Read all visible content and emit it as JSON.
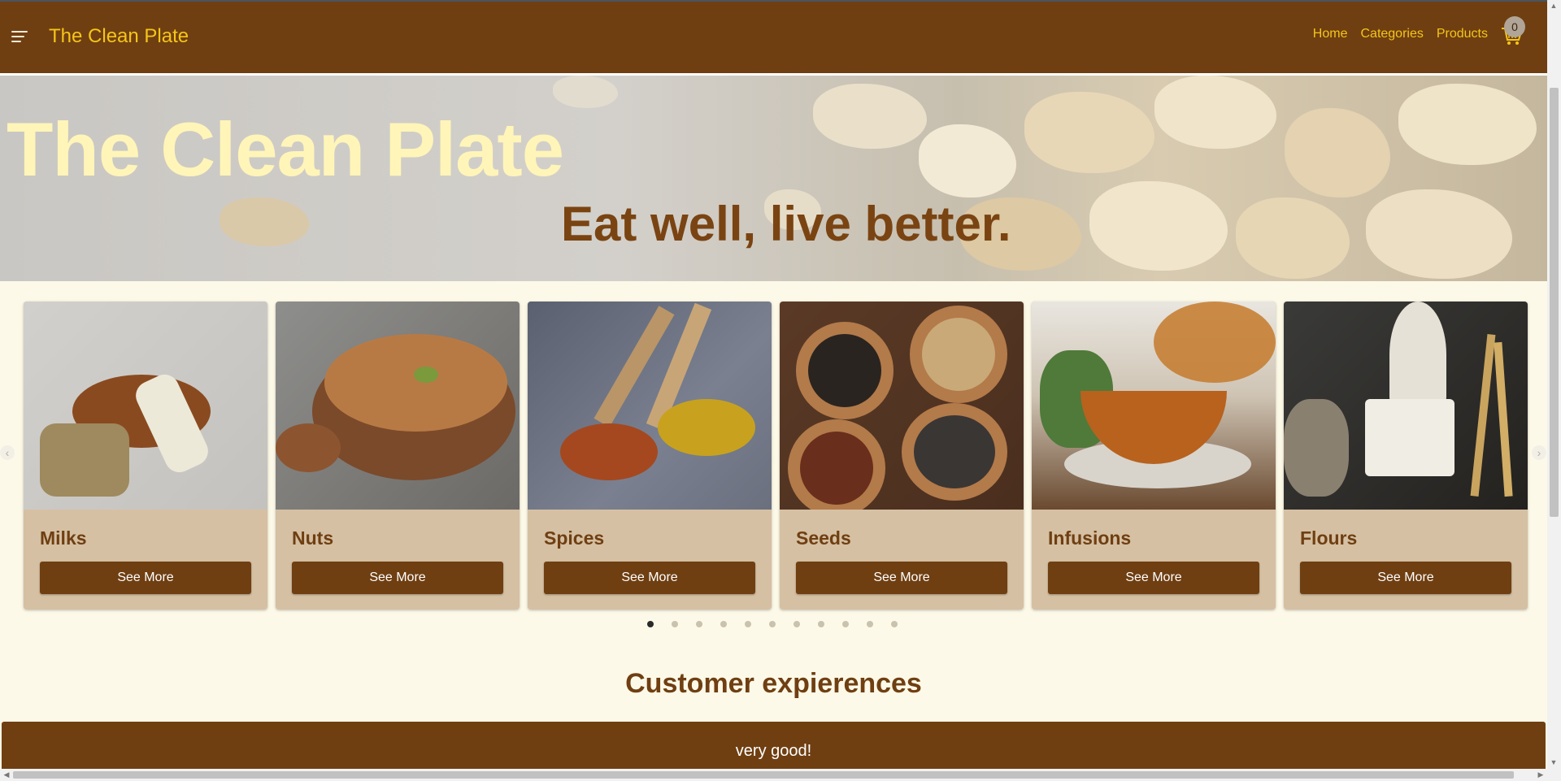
{
  "header": {
    "menu_icon": "hamburger-menu-icon",
    "brand": "The Clean Plate",
    "nav": [
      "Home",
      "Categories",
      "Products"
    ],
    "cart_icon": "shopping-cart-icon",
    "cart_count": "0"
  },
  "hero": {
    "title": "The Clean Plate",
    "subtitle": "Eat well, live better."
  },
  "categories": [
    {
      "name": "Milks",
      "button": "See More"
    },
    {
      "name": "Nuts",
      "button": "See More"
    },
    {
      "name": "Spices",
      "button": "See More"
    },
    {
      "name": "Seeds",
      "button": "See More"
    },
    {
      "name": "Infusions",
      "button": "See More"
    },
    {
      "name": "Flours",
      "button": "See More"
    }
  ],
  "carousel": {
    "page_count": 11,
    "active_page": 1
  },
  "experiences": {
    "title": "Customer expierences",
    "review": "very good!"
  },
  "colors": {
    "primary_brown": "#6f3f12",
    "accent_yellow": "#f5c518",
    "card_tan": "#d6c0a3",
    "page_background": "#fdf9e8"
  }
}
